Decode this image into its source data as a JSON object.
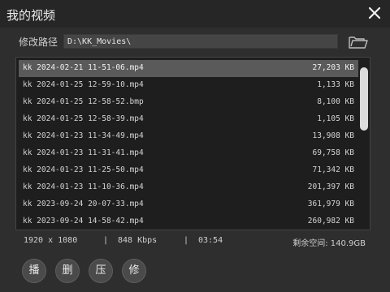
{
  "window": {
    "title": "我的视频"
  },
  "path": {
    "label": "修改路径",
    "value": "D:\\KK_Movies\\"
  },
  "files": [
    {
      "name": "kk 2024-02-21 11-51-06.mp4",
      "size": "27,203 KB",
      "selected": true
    },
    {
      "name": "kk 2024-01-25 12-59-10.mp4",
      "size": "1,133 KB"
    },
    {
      "name": "kk 2024-01-25 12-58-52.bmp",
      "size": "8,100 KB"
    },
    {
      "name": "kk 2024-01-25 12-58-39.mp4",
      "size": "1,105 KB"
    },
    {
      "name": "kk 2024-01-23 11-34-49.mp4",
      "size": "13,908 KB"
    },
    {
      "name": "kk 2024-01-23 11-31-41.mp4",
      "size": "69,758 KB"
    },
    {
      "name": "kk 2024-01-23 11-25-50.mp4",
      "size": "71,342 KB"
    },
    {
      "name": "kk 2024-01-23 11-10-36.mp4",
      "size": "201,397 KB"
    },
    {
      "name": "kk 2023-09-24 20-07-33.mp4",
      "size": "361,979 KB"
    },
    {
      "name": "kk 2023-09-24 14-58-42.mp4",
      "size": "260,982 KB"
    }
  ],
  "status": {
    "resolution": "1920 x 1080",
    "sep1": "|",
    "bitrate": "848 Kbps",
    "sep2": "|",
    "duration": "03:54",
    "free_space": "剩余空间: 140.9GB"
  },
  "actions": [
    {
      "label": "播",
      "name": "play-button"
    },
    {
      "label": "删",
      "name": "delete-button"
    },
    {
      "label": "压",
      "name": "compress-button"
    },
    {
      "label": "修",
      "name": "repair-button"
    }
  ],
  "icons": {
    "close": "close-icon",
    "folder": "folder-open-icon"
  },
  "colors": {
    "background": "#2e2e2e",
    "selected_row": "#5a5a5a",
    "list_background": "#1e1e1e"
  }
}
